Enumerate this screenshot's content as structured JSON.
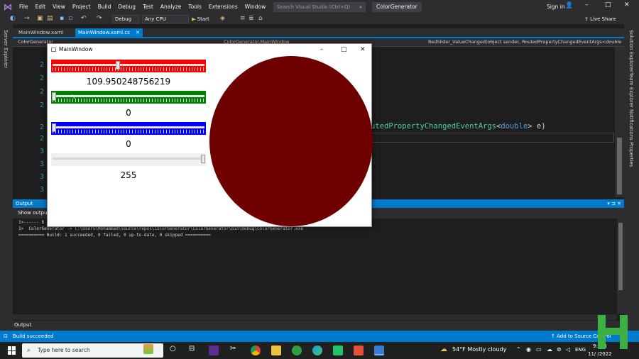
{
  "menubar": {
    "items": [
      "File",
      "Edit",
      "View",
      "Project",
      "Build",
      "Debug",
      "Test",
      "Analyze",
      "Tools",
      "Extensions",
      "Window",
      "Help"
    ],
    "search_placeholder": "Search Visual Studio (Ctrl+Q)",
    "solution_title": "ColorGenerator",
    "sign_in": "Sign in"
  },
  "toolbar": {
    "config": "Debug",
    "platform": "Any CPU",
    "start_label": "Start",
    "live_share": "Live Share"
  },
  "left_strip": {
    "label": "Server Explorer"
  },
  "right_strip": {
    "labels": [
      "Solution Explorer",
      "Team Explorer",
      "Notifications",
      "Properties"
    ]
  },
  "tabs": [
    {
      "label": "MainWindow.xaml"
    },
    {
      "label": "MainWindow.xaml.cs"
    }
  ],
  "navbar": {
    "project": "ColorGenerator",
    "class": "ColorGenerator.MainWindow",
    "member": "RedSlider_ValueChanged(object sender, RoutedPropertyChangedEventArgs<double> e)"
  },
  "editor": {
    "line_numbers": [
      "2",
      "2",
      "2",
      "2",
      "2",
      "2",
      "3",
      "3",
      "3",
      "3"
    ],
    "code_type": "utedPropertyChangedEventArgs",
    "code_kw": "double",
    "code_open": "<",
    "code_close": "> e)"
  },
  "output": {
    "title": "Output",
    "show_from": "Show output",
    "lines": [
      "1>------ B",
      "1>  ColorGenerator -> C:\\Users\\Mohammad\\source\\repos\\ColorGenerator\\ColorGenerator\\bin\\Debug\\ColorGenerator.exe",
      "========== Build: 1 succeeded, 0 failed, 0 up-to-date, 0 skipped =========="
    ],
    "tab_label": "Output"
  },
  "statusbar": {
    "status": "Build succeeded",
    "source_control": "Add to Source Control"
  },
  "taskbar": {
    "search_placeholder": "Type here to search",
    "weather": "54°F  Mostly cloudy",
    "lang": "ENG",
    "time": "9:  PM",
    "date": "11/  /2022"
  },
  "mainwindow": {
    "title": "MainWindow",
    "red_value": "109.950248756219",
    "green_value": "0",
    "blue_value": "0",
    "alpha_value": "255",
    "red_fraction": 0.43,
    "green_fraction": 0.0,
    "blue_fraction": 0.0,
    "alpha_fraction": 1.0,
    "colors": {
      "red_track": "#ff0000",
      "green_track": "#008000",
      "blue_track": "#0000ff",
      "alpha_track": "#f0f0f0",
      "circle": "#6e0000"
    }
  }
}
